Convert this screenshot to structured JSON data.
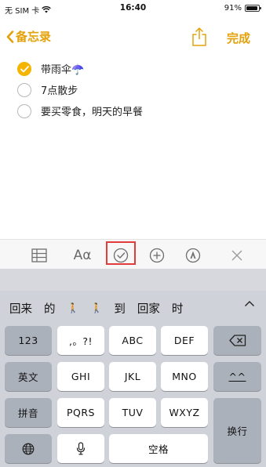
{
  "status_bar": {
    "carrier": "无 SIM 卡",
    "time": "16:40",
    "battery": "91%",
    "battery_level": 0.91
  },
  "nav": {
    "back_label": "备忘录",
    "done_label": "完成",
    "accent_color": "#e3a20b"
  },
  "checklist": [
    {
      "text": "带雨伞☂️",
      "checked": true
    },
    {
      "text": "7点散步",
      "checked": false
    },
    {
      "text": "要买零食，明天的早餐",
      "checked": false
    }
  ],
  "toolbar": {
    "items": [
      "table-icon",
      "text-format-icon",
      "checklist-icon",
      "add-icon",
      "markup-icon",
      "close-icon"
    ],
    "format_label": "Aα",
    "highlighted": "checklist-icon"
  },
  "keyboard": {
    "candidates": [
      "回来",
      "的",
      "🚶",
      "🚶",
      "到",
      "回家",
      "时"
    ],
    "rows": {
      "row1": [
        "123",
        ",。?!",
        "ABC",
        "DEF"
      ],
      "row2": [
        "英文",
        "GHI",
        "JKL",
        "MNO",
        "^^"
      ],
      "row3": [
        "拼音",
        "PQRS",
        "TUV",
        "WXYZ"
      ],
      "row4_space": "空格",
      "return": "换行"
    }
  }
}
